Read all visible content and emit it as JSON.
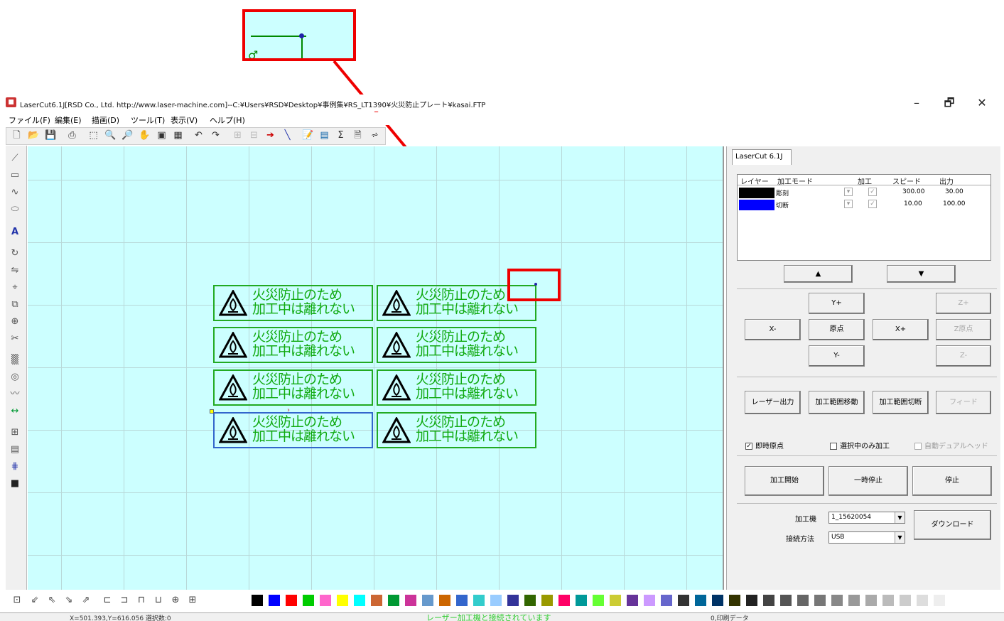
{
  "window": {
    "title": "LaserCut6.1J[RSD Co., Ltd. http://www.laser-machine.com]--C:¥Users¥RSD¥Desktop¥事例集¥RS_LT1390¥火災防止プレート¥kasai.FTP",
    "minimize_glyph": "–",
    "maximize_glyph": "🗗",
    "close_glyph": "✕"
  },
  "menu": [
    {
      "label": "ファイル(F)"
    },
    {
      "label": "編集(E)"
    },
    {
      "label": "描画(D)"
    },
    {
      "label": "ツール(T)"
    },
    {
      "label": "表示(V)"
    },
    {
      "label": "ヘルプ(H)"
    }
  ],
  "toolbar_icons": [
    "new-file-icon",
    "open-file-icon",
    "save-icon",
    "print-icon",
    "select-icon",
    "zoom-in-icon",
    "zoom-out-icon",
    "pan-hand-icon",
    "view-all-icon",
    "grid-view-icon",
    "undo-icon",
    "redo-icon",
    "group-icon",
    "ungroup-icon",
    "arrow-icon",
    "line-tool-icon",
    "property-icon",
    "layer-icon",
    "sigma-icon",
    "preview-icon",
    "path-icon"
  ],
  "left_tools": [
    "line-tool-icon",
    "rectangle-tool-icon",
    "curve-tool-icon",
    "ellipse-tool-icon",
    "text-tool-icon",
    "rotate-icon",
    "mirror-icon",
    "node-edit-icon",
    "array-icon",
    "weld-icon",
    "scissors-icon",
    "fill-pattern-icon",
    "offset-icon",
    "smooth-icon",
    "link-icon",
    "align-icon",
    "distribute-icon",
    "grid-array-icon",
    "fill-black-icon"
  ],
  "plate": {
    "line1": "火災防止のため",
    "line2": "加工中は離れない"
  },
  "right_panel": {
    "tab": "LaserCut 6.1J",
    "layer_headers": [
      "レイヤー",
      "加工モード",
      "加工",
      "スピード",
      "出力"
    ],
    "layers": [
      {
        "color": "#000000",
        "mode": "彫刻",
        "speed": "300.00",
        "power": "30.00"
      },
      {
        "color": "#0000ff",
        "mode": "切断",
        "speed": "10.00",
        "power": "100.00"
      }
    ],
    "up_label": "▲",
    "down_label": "▼",
    "y_plus": "Y+",
    "y_minus": "Y-",
    "x_plus": "X+",
    "x_minus": "X-",
    "origin": "原点",
    "z_plus": "Z+",
    "z_origin": "Z原点",
    "z_minus": "Z-",
    "laser_output": "レーザー出力",
    "range_move": "加工範囲移動",
    "range_cut": "加工範囲切断",
    "feed": "フィード",
    "instant_origin": "即時原点",
    "selected_only": "選択中のみ加工",
    "auto_dual_head": "自動デュアルヘッド",
    "start": "加工開始",
    "pause": "一時停止",
    "stop": "停止",
    "machine_label": "加工機",
    "machine_value": "1_15620054",
    "connection_label": "接続方法",
    "connection_value": "USB",
    "download": "ダウンロード"
  },
  "bottom_tools": [
    "snap-icon",
    "align-bottom-left-icon",
    "align-top-left-icon",
    "align-bottom-right-icon",
    "align-top-right-icon",
    "distribute-h-icon",
    "distribute-v-icon",
    "same-size-icon",
    "center-icon",
    "grid-icon",
    "layers-icon"
  ],
  "palette": [
    "#000000",
    "#0000ff",
    "#ff0000",
    "#00cc00",
    "#ff66cc",
    "#ffff00",
    "#00ffff",
    "#cc6633",
    "#009933",
    "#cc3399",
    "#6699cc",
    "#cc6600",
    "#3366cc",
    "#33cccc",
    "#99ccff",
    "#333399",
    "#336600",
    "#999900",
    "#ff0066",
    "#009999",
    "#66ff33",
    "#cccc33",
    "#663399",
    "#cc99ff",
    "#6666cc",
    "#333333",
    "#006699",
    "#003366",
    "#333300",
    "#222222",
    "#444444",
    "#555555",
    "#666666",
    "#777777",
    "#888888",
    "#999999",
    "#aaaaaa",
    "#bbbbbb",
    "#cccccc",
    "#dddddd",
    "#eeeeee"
  ],
  "status": {
    "coords": "X=501.393,Y=616.056 選択数:0",
    "message": "レーザー加工機と接続されています",
    "print_data": "0,印刷データ"
  }
}
